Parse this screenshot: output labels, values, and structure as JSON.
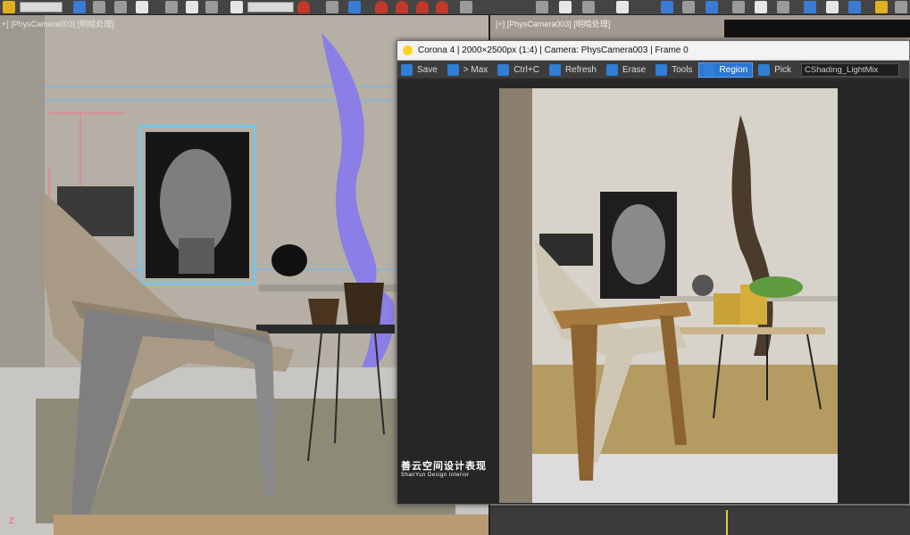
{
  "viewports": {
    "left_label": "+] [PhysCamera003] [明暗处理]",
    "right_label": "[+] [PhysCamera003] [明暗处理]"
  },
  "corona": {
    "title": "Corona 4 | 2000×2500px (1:4) | Camera: PhysCamera003 | Frame 0",
    "tools": {
      "save": "Save",
      "max": "> Max",
      "ctrlc": "Ctrl+C",
      "refresh": "Refresh",
      "erase": "Erase",
      "tools": "Tools",
      "region": "Region",
      "pick": "Pick"
    },
    "pass": "CShading_LightMix"
  },
  "watermark": {
    "cn": "善云空间设计表现",
    "en": "ShanYun Design Interior"
  },
  "colors": {
    "accent": "#2a76d2",
    "viewport_wall": "#b7b0a6",
    "selection": "#5fd0ff"
  }
}
